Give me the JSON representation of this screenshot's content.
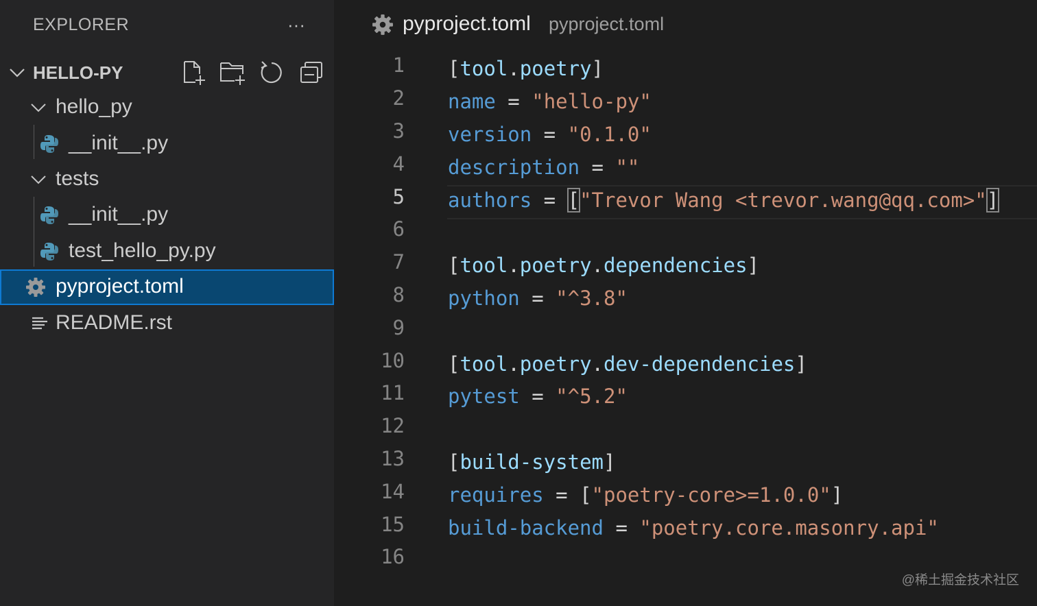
{
  "sidebar": {
    "title": "EXPLORER",
    "more_label": "···",
    "project_name": "HELLO-PY",
    "tree": [
      {
        "label": "hello_py",
        "type": "folder"
      },
      {
        "label": "__init__.py",
        "type": "python"
      },
      {
        "label": "tests",
        "type": "folder"
      },
      {
        "label": "__init__.py",
        "type": "python"
      },
      {
        "label": "test_hello_py.py",
        "type": "python"
      },
      {
        "label": "pyproject.toml",
        "type": "toml",
        "selected": true
      },
      {
        "label": "README.rst",
        "type": "text"
      }
    ]
  },
  "editor": {
    "breadcrumb_file": "pyproject.toml",
    "breadcrumb_path": "pyproject.toml",
    "line_numbers": [
      "1",
      "2",
      "3",
      "4",
      "5",
      "6",
      "7",
      "8",
      "9",
      "10",
      "11",
      "12",
      "13",
      "14",
      "15",
      "16"
    ],
    "active_line": "5",
    "code": {
      "l1": {
        "open": "[",
        "a": "tool",
        "dot1": ".",
        "b": "poetry",
        "close": "]"
      },
      "l2": {
        "key": "name",
        "eq": " = ",
        "val": "\"hello-py\""
      },
      "l3": {
        "key": "version",
        "eq": " = ",
        "val": "\"0.1.0\""
      },
      "l4": {
        "key": "description",
        "eq": " = ",
        "val": "\"\""
      },
      "l5": {
        "key": "authors",
        "eq": " = ",
        "open": "[",
        "val": "\"Trevor Wang <trevor.wang@qq.com>\"",
        "close": "]"
      },
      "l7": {
        "open": "[",
        "a": "tool",
        "dot1": ".",
        "b": "poetry",
        "dot2": ".",
        "c": "dependencies",
        "close": "]"
      },
      "l8": {
        "key": "python",
        "eq": " = ",
        "val": "\"^3.8\""
      },
      "l10": {
        "open": "[",
        "a": "tool",
        "dot1": ".",
        "b": "poetry",
        "dot2": ".",
        "c": "dev-dependencies",
        "close": "]"
      },
      "l11": {
        "key": "pytest",
        "eq": " = ",
        "val": "\"^5.2\""
      },
      "l13": {
        "open": "[",
        "a": "build-system",
        "close": "]"
      },
      "l14": {
        "key": "requires",
        "eq": " = ",
        "open": "[",
        "val": "\"poetry-core>=1.0.0\"",
        "close": "]"
      },
      "l15": {
        "key": "build-backend",
        "eq": " = ",
        "val": "\"poetry.core.masonry.api\""
      }
    }
  },
  "watermark": "@稀土掘金技术社区",
  "colors": {
    "sidebar_bg": "#252526",
    "editor_bg": "#1e1e1e",
    "selection": "#094771",
    "keyword": "#569cd6",
    "string": "#ce9178",
    "table_name": "#9cdcfe",
    "python_icon": "#519aba"
  },
  "icons": {
    "new_file": "new-file-icon",
    "new_folder": "new-folder-icon",
    "refresh": "refresh-icon",
    "collapse_all": "collapse-all-icon",
    "gear": "gear-icon",
    "python": "python-icon",
    "readme": "lines-icon"
  }
}
